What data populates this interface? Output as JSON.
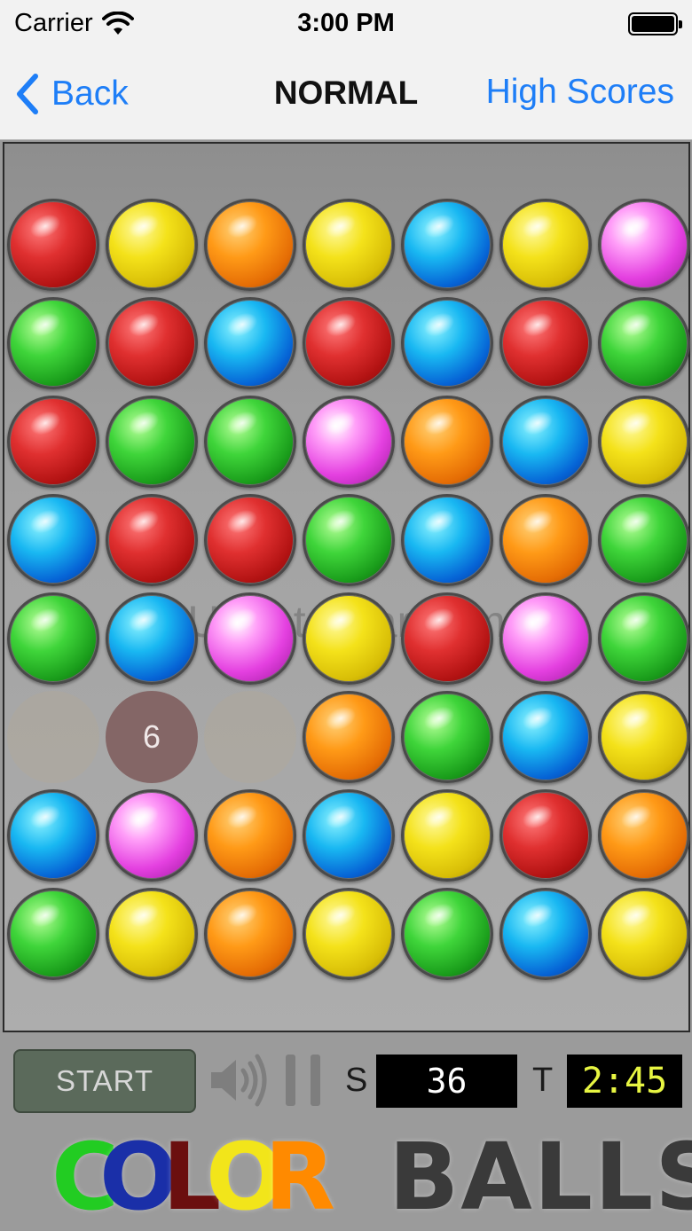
{
  "status_bar": {
    "carrier": "Carrier",
    "time": "3:00 PM"
  },
  "nav": {
    "back_label": "Back",
    "title": "NORMAL",
    "high_scores_label": "High Scores"
  },
  "board": {
    "rows": [
      [
        "red",
        "yellow",
        "orange",
        "yellow",
        "blue",
        "yellow",
        "pink"
      ],
      [
        "green",
        "red",
        "blue",
        "red",
        "blue",
        "red",
        "green"
      ],
      [
        "red",
        "green",
        "green",
        "pink",
        "orange",
        "blue",
        "yellow"
      ],
      [
        "blue",
        "red",
        "red",
        "green",
        "blue",
        "orange",
        "green"
      ],
      [
        "green",
        "blue",
        "pink",
        "yellow",
        "red",
        "pink",
        "green"
      ],
      [
        "empty",
        "counter",
        "empty",
        "orange",
        "green",
        "blue",
        "yellow"
      ],
      [
        "blue",
        "pink",
        "orange",
        "blue",
        "yellow",
        "red",
        "orange"
      ],
      [
        "green",
        "yellow",
        "orange",
        "yellow",
        "green",
        "blue",
        "yellow"
      ]
    ],
    "counter_value": "6",
    "watermark": "UpdateStar.com"
  },
  "controls": {
    "start_label": "START",
    "score_label": "S",
    "score_value": "36",
    "time_label": "T",
    "time_value": "2:45"
  },
  "logo": {
    "word1": [
      {
        "char": "C",
        "color": "#22cc22"
      },
      {
        "char": "O",
        "color": "#1a2fa8"
      },
      {
        "char": "L",
        "color": "#6b0f0f"
      },
      {
        "char": "O",
        "color": "#f2e51a"
      },
      {
        "char": "R",
        "color": "#ff8a00"
      }
    ],
    "word2": "BALLS",
    "word2_color": "#3a3a3a"
  }
}
